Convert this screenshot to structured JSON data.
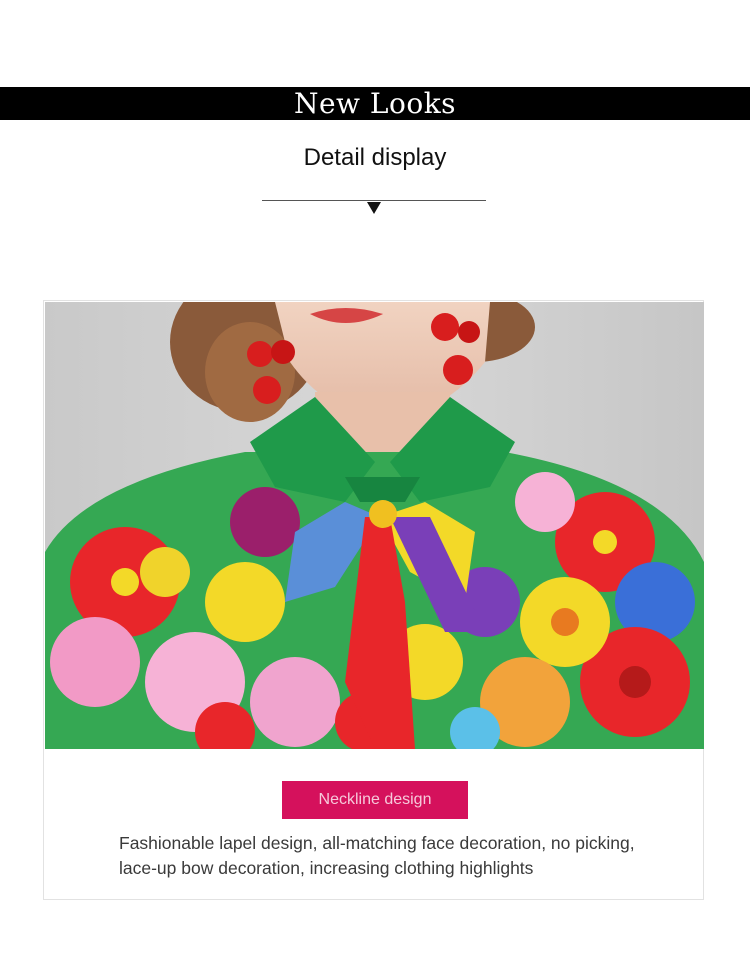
{
  "banner": {
    "title": "New Looks"
  },
  "section": {
    "title": "Detail display"
  },
  "detail_card": {
    "photo_alt": "Woman in floral print shirt with green collar and bow, red bead earrings",
    "tag_label": "Neckline design",
    "description": "Fashionable lapel design, all-matching face decoration, no picking, lace-up bow decoration, increasing clothing highlights"
  },
  "colors": {
    "banner_bg": "#000000",
    "tag_bg": "#d5115c",
    "collar_green": "#1f9a4a",
    "earring_red": "#d81e1e"
  }
}
